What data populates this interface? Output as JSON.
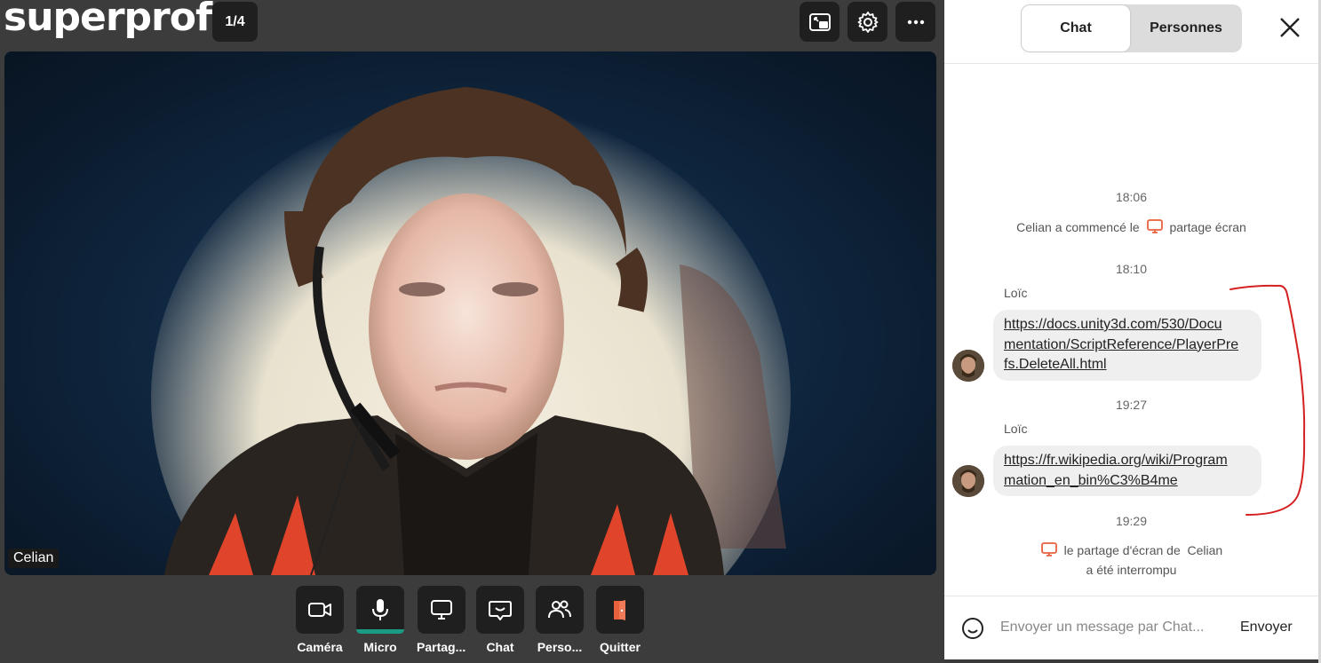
{
  "app": {
    "logo": "superprof",
    "pager": "1/4"
  },
  "video": {
    "participant_name": "Celian"
  },
  "controls": [
    {
      "label": "Caméra",
      "icon": "camera-icon"
    },
    {
      "label": "Micro",
      "icon": "microphone-icon"
    },
    {
      "label": "Partag...",
      "icon": "screen-share-icon"
    },
    {
      "label": "Chat",
      "icon": "chat-icon"
    },
    {
      "label": "Perso...",
      "icon": "people-icon"
    },
    {
      "label": "Quitter",
      "icon": "exit-door-icon"
    }
  ],
  "top_buttons": [
    {
      "icon": "picture-in-picture-icon"
    },
    {
      "icon": "gear-icon"
    },
    {
      "icon": "more-dots-icon"
    }
  ],
  "panel": {
    "tabs": [
      "Chat",
      "Personnes"
    ],
    "messages": {
      "t1": "18:06",
      "sys1_a": "Celian a commencé le",
      "sys1_b": "partage écran",
      "t2": "18:10",
      "author1": "Loïc",
      "link1_l1": "https://docs.unity3d.com/530/Docu",
      "link1_l2": "mentation/ScriptReference/PlayerPre",
      "link1_l3": "fs.DeleteAll.html",
      "t3": "19:27",
      "author2": "Loïc",
      "link2_l1": "https://fr.wikipedia.org/wiki/Program",
      "link2_l2": "mation_en_bin%C3%B4me",
      "t4": "19:29",
      "sys2_a": "le partage d'écran de",
      "sys2_name": "Celian",
      "sys2_b": "a été interrompu"
    },
    "input_placeholder": "Envoyer un message par Chat...",
    "send_label": "Envoyer"
  },
  "colors": {
    "accent_orange": "#e8603c",
    "mic_active": "#1a9c84",
    "annotation_red": "#d42020"
  }
}
